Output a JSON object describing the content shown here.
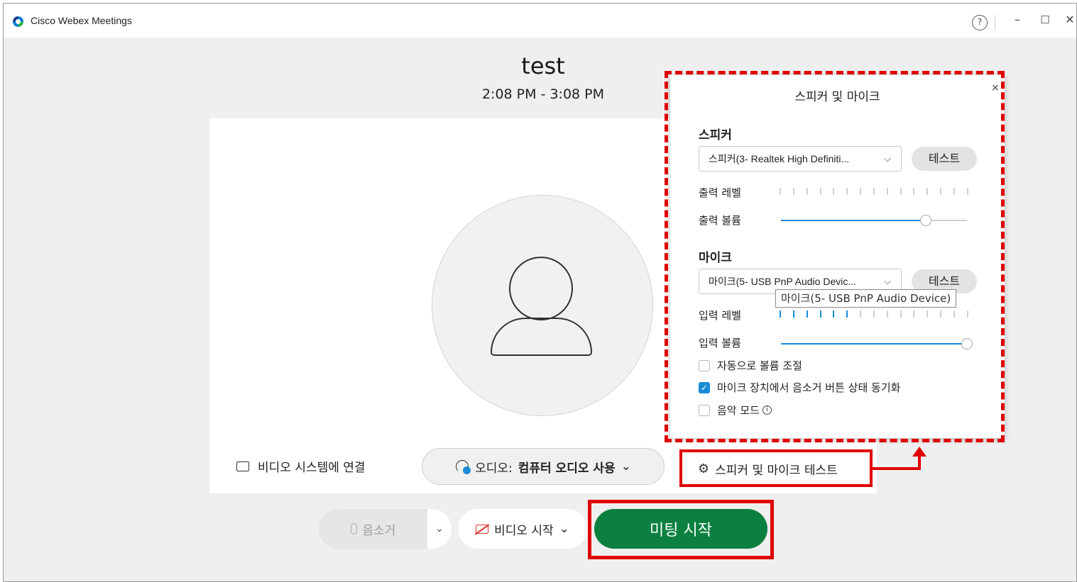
{
  "window": {
    "app_title": "Cisco Webex Meetings",
    "help_label": "?",
    "minimize_label": "–",
    "maximize_label": "☐",
    "close_label": "✕"
  },
  "meeting": {
    "title": "test",
    "time": "2:08 PM - 3:08 PM"
  },
  "preview": {
    "connect_video_label": "비디오 시스템에 연결",
    "audio_label": "오디오:",
    "audio_value": "컴퓨터 오디오 사용",
    "audio_chevron": "⌄",
    "test_link_label": "스피커 및 마이크 테스트"
  },
  "controls": {
    "mute_label": "음소거",
    "mute_chevron": "⌄",
    "video_label": "비디오 시작",
    "video_chevron": "⌄",
    "start_label": "미팅 시작"
  },
  "panel": {
    "title": "스피커 및 마이크",
    "close_label": "×",
    "speaker": {
      "section": "스피커",
      "device": "스피커(3- Realtek High Definiti...",
      "test_label": "테스트",
      "output_level_label": "출력 레벨",
      "output_level_value": 0,
      "output_volume_label": "출력 볼륨",
      "output_volume_value": 0.78
    },
    "mic": {
      "section": "마이크",
      "device": "마이크(5- USB PnP Audio Devic...",
      "test_label": "테스트",
      "input_level_label": "입력 레벨",
      "input_level_value": 0.4,
      "input_volume_label": "입력 볼륨",
      "input_volume_value": 1.0
    },
    "options": [
      {
        "label": "자동으로 볼륨 조절",
        "checked": false
      },
      {
        "label": "마이크 장치에서 음소거 버튼 상태 동기화",
        "checked": true
      },
      {
        "label": "음악 모드",
        "checked": false
      }
    ],
    "tooltip": "마이크(5- USB PnP Audio Device)"
  },
  "icons": {
    "checkmark": "✓",
    "info": "i",
    "gear": "⚙",
    "chevron_down": "⌵"
  },
  "colors": {
    "accent": "#1a8cd8",
    "start_button": "#0b8040",
    "highlight": "#e00000"
  }
}
